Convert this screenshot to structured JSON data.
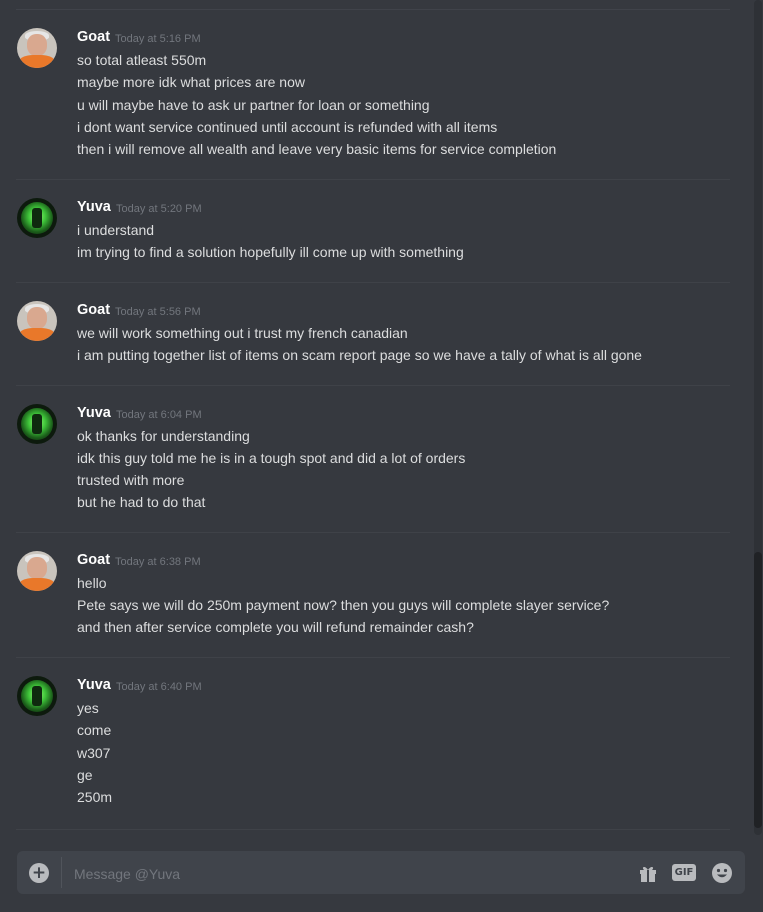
{
  "messages": [
    {
      "author": "Goat",
      "timestamp": "Today at 5:16 PM",
      "lines": [
        "so total atleast 550m",
        "maybe more idk what prices are now",
        "u will maybe have to ask ur partner for loan or something",
        "i dont want service continued until account is refunded with all items",
        "then i will remove all wealth and leave very basic items for service completion"
      ]
    },
    {
      "author": "Yuva",
      "timestamp": "Today at 5:20 PM",
      "lines": [
        "i understand",
        "im trying to find a solution hopefully ill come up with something"
      ]
    },
    {
      "author": "Goat",
      "timestamp": "Today at 5:56 PM",
      "lines": [
        "we will work something out i trust my french canadian",
        "i am putting together list of items on scam report page so we have a tally of what is all gone"
      ]
    },
    {
      "author": "Yuva",
      "timestamp": "Today at 6:04 PM",
      "lines": [
        "ok thanks for understanding",
        "idk this guy told me he is in a tough spot and did a lot of orders",
        "trusted with more",
        "but he had to do that"
      ]
    },
    {
      "author": "Goat",
      "timestamp": "Today at 6:38 PM",
      "lines": [
        "hello",
        "Pete says we will do 250m payment now? then you guys will complete slayer service?",
        "and then after service complete you will refund remainder cash?"
      ]
    },
    {
      "author": "Yuva",
      "timestamp": "Today at 6:40 PM",
      "lines": [
        "yes",
        "come",
        "w307",
        "ge",
        "250m"
      ]
    }
  ],
  "composer": {
    "placeholder": "Message @Yuva",
    "gif_label": "GIF",
    "plus_glyph": "+"
  }
}
